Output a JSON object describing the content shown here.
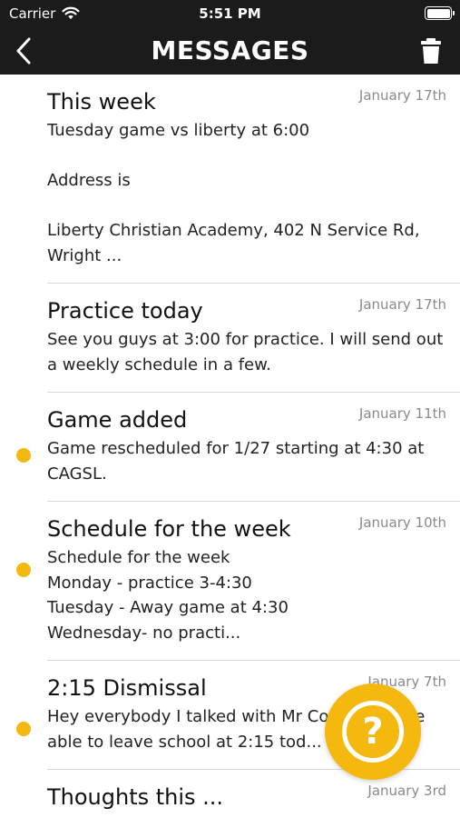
{
  "status_bar": {
    "carrier": "Carrier",
    "time": "5:51 PM"
  },
  "header": {
    "title": "MESSAGES"
  },
  "messages": [
    {
      "title": "This week",
      "date": "January 17th",
      "body": "Tuesday game vs liberty at 6:00\n\nAddress is\n\nLiberty Christian Academy, 402 N Service Rd, Wright ...",
      "unread": false
    },
    {
      "title": "Practice today",
      "date": "January 17th",
      "body": "See you guys at 3:00 for practice. I will send out a weekly schedule in a few.",
      "unread": false
    },
    {
      "title": "Game added",
      "date": "January 11th",
      "body": "Game rescheduled for 1/27 starting at 4:30 at CAGSL.",
      "unread": true
    },
    {
      "title": "Schedule for the week",
      "date": "January 10th",
      "body": "Schedule for the week\n Monday - practice 3-4:30\nTuesday - Away game  at 4:30\nWednesday- no practi...",
      "unread": true
    },
    {
      "title": "2:15 Dismissal",
      "date": "January 7th",
      "body": "Hey everybody I talked with Mr Co... ...uys are able to leave school at 2:15 tod... ...u at t...",
      "unread": true
    },
    {
      "title": "Thoughts this ...",
      "date": "January 3rd",
      "body": "",
      "unread": false
    }
  ],
  "help_button": {
    "glyph": "?"
  },
  "colors": {
    "header_bg": "#1b1b1b",
    "accent": "#f5b80f",
    "divider": "#d9d9d9",
    "date_text": "#8a8a8a"
  },
  "icons": {
    "back": "chevron-left-icon",
    "delete": "trash-icon",
    "help": "question-circle-icon",
    "wifi": "wifi-icon",
    "battery": "battery-icon"
  }
}
